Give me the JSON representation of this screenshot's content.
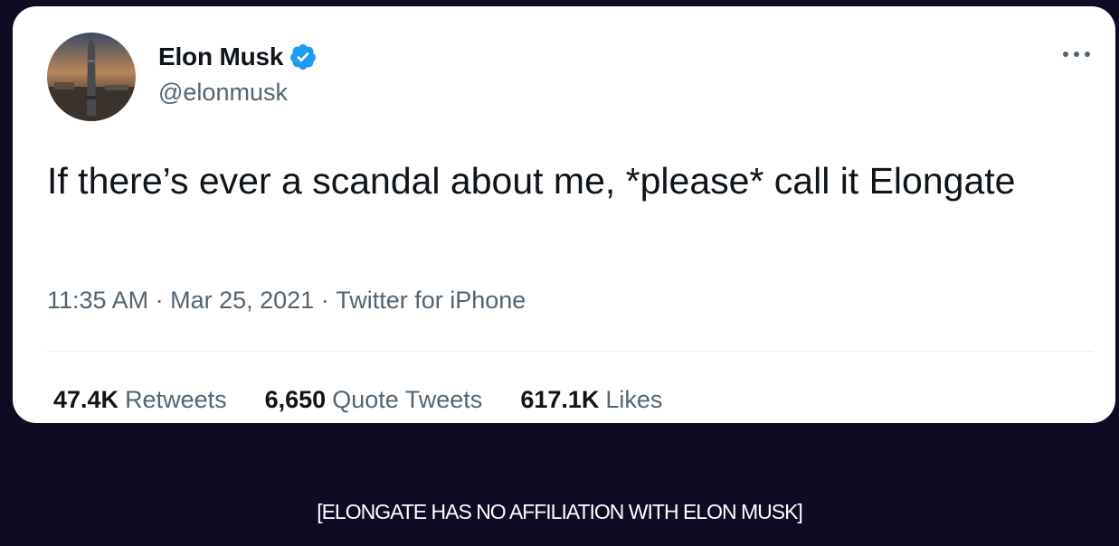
{
  "tweet": {
    "author": {
      "display_name": "Elon Musk",
      "handle": "@elonmusk",
      "verified": true,
      "avatar_icon": "starship-avatar-icon"
    },
    "text": "If there’s ever a scandal about me, *please* call it Elongate",
    "meta": {
      "time": "11:35 AM",
      "separator": " · ",
      "date": "Mar 25, 2021",
      "source": "Twitter for iPhone"
    },
    "stats": {
      "retweets": {
        "count": "47.4K",
        "label": "Retweets"
      },
      "quote_tweets": {
        "count": "6,650",
        "label": "Quote Tweets"
      },
      "likes": {
        "count": "617.1K",
        "label": "Likes"
      }
    }
  },
  "colors": {
    "page_background": "#0d0c22",
    "card_background": "#ffffff",
    "verified_blue": "#1d9bf0",
    "secondary_text": "#536471",
    "primary_text": "#0f1419"
  },
  "disclaimer": "[ELONGATE HAS NO AFFILIATION WITH ELON MUSK]"
}
